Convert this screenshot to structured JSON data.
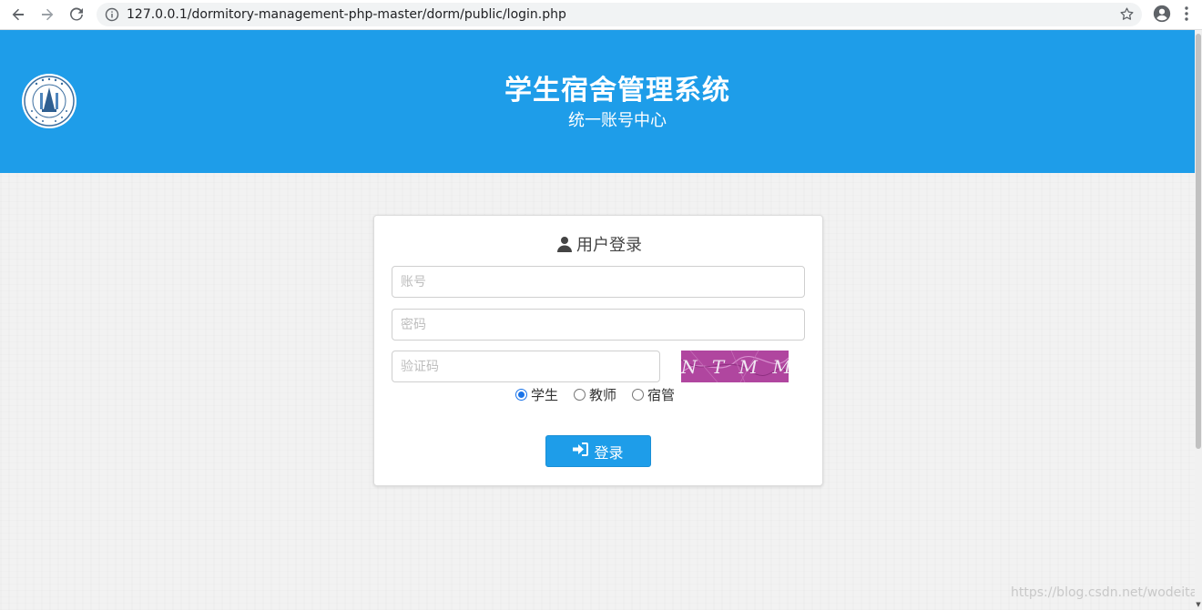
{
  "browser": {
    "url": "127.0.0.1/dormitory-management-php-master/dorm/public/login.php",
    "icons": [
      "back-icon",
      "forward-icon",
      "reload-icon",
      "info-icon",
      "star-icon",
      "account-icon",
      "menu-icon"
    ]
  },
  "header": {
    "title": "学生宿舍管理系统",
    "subtitle": "统一账号中心",
    "background": "#1e9de9"
  },
  "login": {
    "title": "用户登录",
    "username_placeholder": "账号",
    "password_placeholder": "密码",
    "captcha_placeholder": "验证码",
    "captcha_text": "N T M M",
    "roles": [
      {
        "label": "学生",
        "checked": true
      },
      {
        "label": "教师",
        "checked": false
      },
      {
        "label": "宿管",
        "checked": false
      }
    ],
    "submit_label": "登录"
  },
  "watermark": "https://blog.csdn.net/wodeita"
}
